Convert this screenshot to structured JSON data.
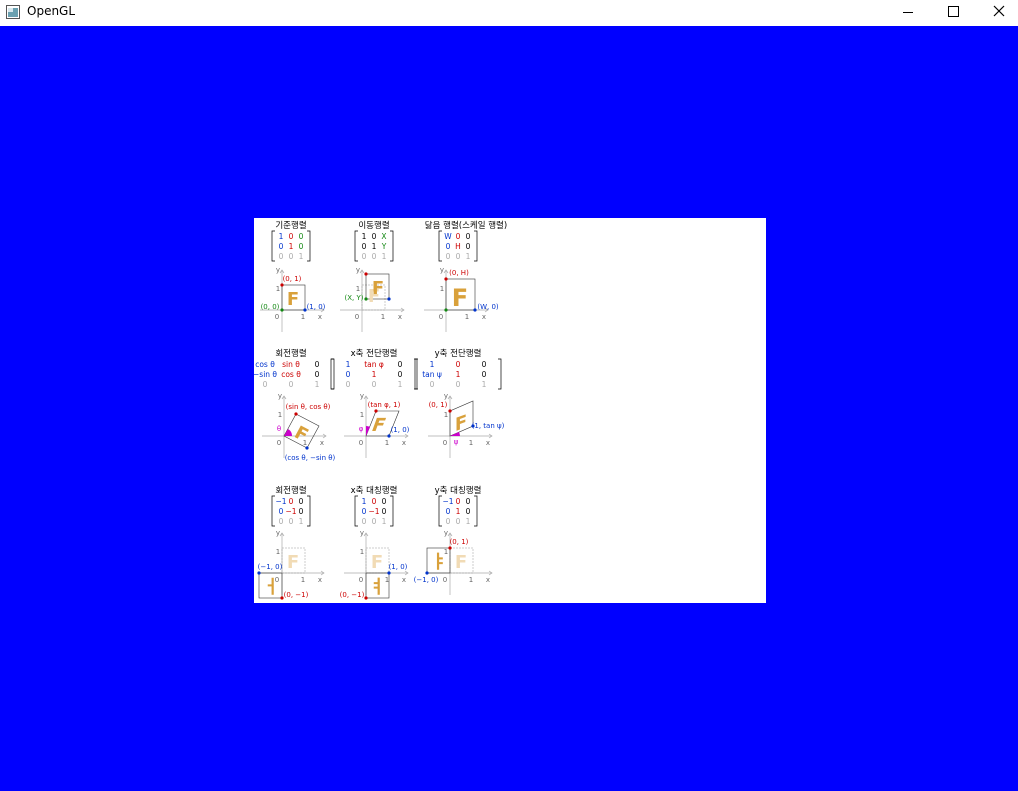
{
  "window": {
    "title": "OpenGL",
    "icons": {
      "app": "opengl-window-icon",
      "minimize": "minimize-icon",
      "maximize": "maximize-icon",
      "close": "close-icon"
    }
  },
  "colors": {
    "background": "#0000ff",
    "panel": "#ffffff",
    "glyph": "#d9a13b",
    "glyph_faded": "#f1dbb5",
    "red": "#cc0000",
    "green": "#118811",
    "blue": "#0033cc",
    "magenta": "#cc00cc",
    "gray": "#aaaaaa"
  },
  "figure": {
    "glyph_char": "F",
    "glyph_flip_y": "ㅕ",
    "glyph_flip_x": "ㅑ",
    "glyph_rot": "ㅓ",
    "axis": {
      "x": "x",
      "y": "y",
      "zero": "0",
      "one": "1"
    },
    "rows": [
      [
        {
          "title": "기준행렬",
          "matrix": [
            [
              "1",
              "0",
              "0"
            ],
            [
              "0",
              "1",
              "0"
            ],
            [
              "0",
              "0",
              "1"
            ]
          ],
          "labels": {
            "top": "(0, 1)",
            "origin": "(0, 0)",
            "right": "(1, 0)"
          }
        },
        {
          "title": "이동행렬",
          "matrix": [
            [
              "1",
              "0",
              "X"
            ],
            [
              "0",
              "1",
              "Y"
            ],
            [
              "0",
              "0",
              "1"
            ]
          ],
          "labels": {
            "point": "(X, Y)"
          }
        },
        {
          "title": "닮음 행렬(스케일 행렬)",
          "matrix": [
            [
              "W",
              "0",
              "0"
            ],
            [
              "0",
              "H",
              "0"
            ],
            [
              "0",
              "0",
              "1"
            ]
          ],
          "labels": {
            "top": "(0, H)",
            "right": "(W, 0)"
          }
        }
      ],
      [
        {
          "title": "회전행렬",
          "matrix": [
            [
              "cos θ",
              "sin θ",
              "0"
            ],
            [
              "−sin θ",
              "cos θ",
              "0"
            ],
            [
              "0",
              "0",
              "1"
            ]
          ],
          "labels": {
            "top": "(sin θ, cos θ)",
            "bottom": "(cos θ, −sin θ)",
            "angle": "θ"
          }
        },
        {
          "title": "x축 전단행렬",
          "matrix": [
            [
              "1",
              "tan φ",
              "0"
            ],
            [
              "0",
              "1",
              "0"
            ],
            [
              "0",
              "0",
              "1"
            ]
          ],
          "labels": {
            "top": "(tan φ, 1)",
            "right": "(1, 0)",
            "angle": "φ"
          }
        },
        {
          "title": "y축 전단행렬",
          "matrix": [
            [
              "1",
              "0",
              "0"
            ],
            [
              "tan ψ",
              "1",
              "0"
            ],
            [
              "0",
              "0",
              "1"
            ]
          ],
          "labels": {
            "top": "(0, 1)",
            "right": "(1, tan ψ)",
            "angle": "ψ"
          }
        }
      ],
      [
        {
          "title": "회전행렬",
          "matrix": [
            [
              "−1",
              "0",
              "0"
            ],
            [
              "0",
              "−1",
              "0"
            ],
            [
              "0",
              "0",
              "1"
            ]
          ],
          "labels": {
            "left": "(−1, 0)",
            "bottom": "(0, −1)"
          }
        },
        {
          "title": "x축 대칭행렬",
          "matrix": [
            [
              "1",
              "0",
              "0"
            ],
            [
              "0",
              "−1",
              "0"
            ],
            [
              "0",
              "0",
              "1"
            ]
          ],
          "labels": {
            "right": "(1, 0)",
            "bottom": "(0, −1)"
          }
        },
        {
          "title": "y축 대칭행렬",
          "matrix": [
            [
              "−1",
              "0",
              "0"
            ],
            [
              "0",
              "1",
              "0"
            ],
            [
              "0",
              "0",
              "1"
            ]
          ],
          "labels": {
            "top": "(0, 1)",
            "left": "(−1, 0)"
          }
        }
      ]
    ]
  }
}
